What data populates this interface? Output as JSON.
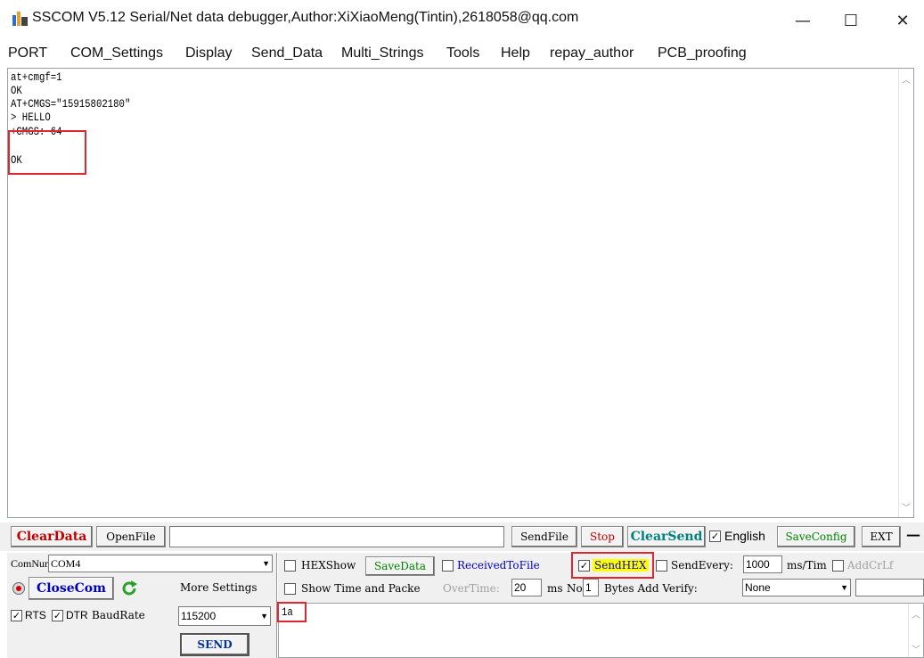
{
  "window": {
    "title": "SSCOM V5.12 Serial/Net data debugger,Author:XiXiaoMeng(Tintin),2618058@qq.com",
    "minimize": "—",
    "maximize": "☐",
    "close": "✕"
  },
  "menu": [
    "PORT",
    "COM_Settings",
    "Display",
    "Send_Data",
    "Multi_Strings",
    "Tools",
    "Help",
    "repay_author",
    "PCB_proofing"
  ],
  "output_lines": [
    "at+cmgf=1",
    "OK",
    "AT+CMGS=\"15915802180\"",
    "> HELLO",
    "+CMGS: 64",
    "",
    "OK"
  ],
  "toolbar": {
    "clear_data": "ClearData",
    "open_file": "OpenFile",
    "file_path": "",
    "send_file": "SendFile",
    "stop": "Stop",
    "clear_send": "ClearSend",
    "english_checked": "✓",
    "english": "English",
    "save_config": "SaveConfig",
    "ext": "EXT",
    "dash": "—"
  },
  "port": {
    "comnum_label": "ComNum",
    "comnum_value": "COM4",
    "close_com": "CloseCom",
    "more_settings": "More Settings",
    "rts_label": "RTS",
    "dtr_label": "DTR",
    "baud_label": "BaudRate",
    "baud_value": "115200",
    "send": "SEND"
  },
  "options": {
    "hexshow": "HEXShow",
    "savedata": "SaveData",
    "received_to_file": "ReceivedToFile",
    "sendhex": "SendHEX",
    "sendhex_checked": "✓",
    "send_every": "SendEvery:",
    "send_every_value": "1000",
    "ms_tim": "ms/Tim",
    "add_crlf": "AddCrLf",
    "show_time": "Show Time and Packe",
    "overtime": "OverTime:",
    "overtime_value": "20",
    "ms": "ms",
    "no": "No",
    "no_value": "1",
    "bytes_add_verify": "Bytes Add Verify:",
    "verify_value": "None"
  },
  "send_text": "1a",
  "colors": {
    "highlight_red": "#e0262f",
    "sendhex_bg": "#ffff00",
    "clear_red": "#c00000",
    "blue": "#0000c0",
    "green": "#008000"
  }
}
